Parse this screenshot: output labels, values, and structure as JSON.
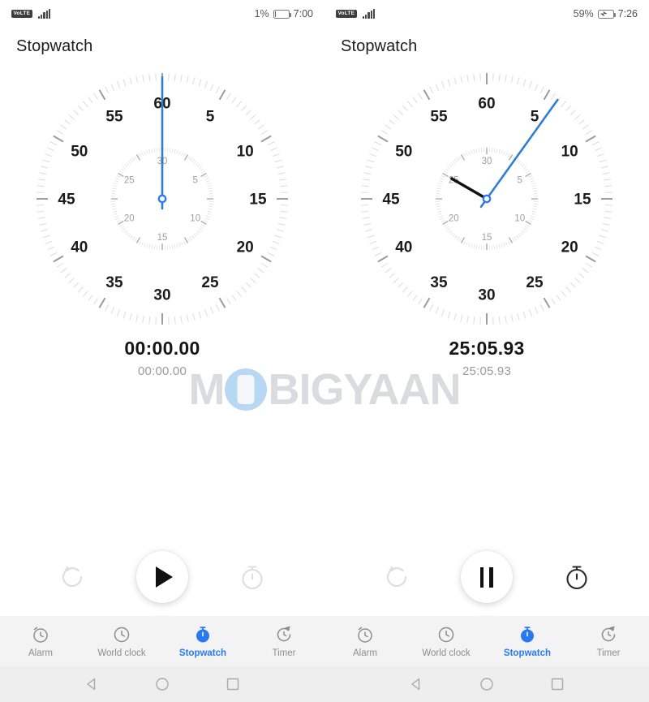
{
  "panels": [
    {
      "statusbar": {
        "volte": "VoLTE",
        "signal_icon": "signal-bars-icon",
        "battery_percent": "1%",
        "battery_icon": "battery-icon",
        "battery_level": 6,
        "charging": false,
        "time": "7:00"
      },
      "title": "Stopwatch",
      "dial": {
        "outer_numbers": [
          "60",
          "5",
          "10",
          "15",
          "20",
          "25",
          "30",
          "35",
          "40",
          "45",
          "50",
          "55"
        ],
        "inner_numbers": [
          "30",
          "5",
          "10",
          "15",
          "20",
          "25"
        ],
        "second_hand_angle": 0,
        "minute_hand_angle": 0,
        "minute_hand_visible": false,
        "hand_color": "#2f7fd0",
        "pivot_color": "#2979f2"
      },
      "time_main": "00:00.00",
      "time_sub": "00:00.00",
      "controls": {
        "reset_icon": "reset-icon",
        "reset_enabled": false,
        "main_icon": "play-icon",
        "main_action": "start",
        "lap_icon": "lap-timer-icon",
        "lap_enabled": false
      }
    },
    {
      "statusbar": {
        "volte": "VoLTE",
        "signal_icon": "signal-bars-icon",
        "battery_percent": "59%",
        "battery_icon": "battery-charging-icon",
        "battery_level": 59,
        "charging": true,
        "time": "7:26"
      },
      "title": "Stopwatch",
      "dial": {
        "outer_numbers": [
          "60",
          "5",
          "10",
          "15",
          "20",
          "25",
          "30",
          "35",
          "40",
          "45",
          "50",
          "55"
        ],
        "inner_numbers": [
          "30",
          "5",
          "10",
          "15",
          "20",
          "25"
        ],
        "second_hand_angle": 35.6,
        "minute_hand_angle": 300,
        "minute_hand_visible": true,
        "hand_color": "#2f7fd0",
        "pivot_color": "#2979f2"
      },
      "time_main": "25:05.93",
      "time_sub": "25:05.93",
      "controls": {
        "reset_icon": "reset-icon",
        "reset_enabled": false,
        "main_icon": "pause-icon",
        "main_action": "pause",
        "lap_icon": "lap-timer-icon",
        "lap_enabled": true
      }
    }
  ],
  "tabs": [
    {
      "label": "Alarm",
      "icon": "alarm-clock-icon",
      "active": false
    },
    {
      "label": "World clock",
      "icon": "world-clock-icon",
      "active": false
    },
    {
      "label": "Stopwatch",
      "icon": "stopwatch-icon",
      "active": true
    },
    {
      "label": "Timer",
      "icon": "timer-icon",
      "active": false
    }
  ],
  "navbar": [
    {
      "icon": "back-icon"
    },
    {
      "icon": "home-icon"
    },
    {
      "icon": "recents-icon"
    }
  ],
  "watermark": {
    "before": "M",
    "after": "BIGYAAN"
  },
  "colors": {
    "accent": "#2979f2",
    "hand": "#2f7fd0",
    "tab_inactive": "#8e8e8e",
    "tabbar_bg": "#f3f3f3",
    "navbar_bg": "#eeeeee",
    "time_main": "#151515",
    "time_sub": "#9b9b9b"
  }
}
